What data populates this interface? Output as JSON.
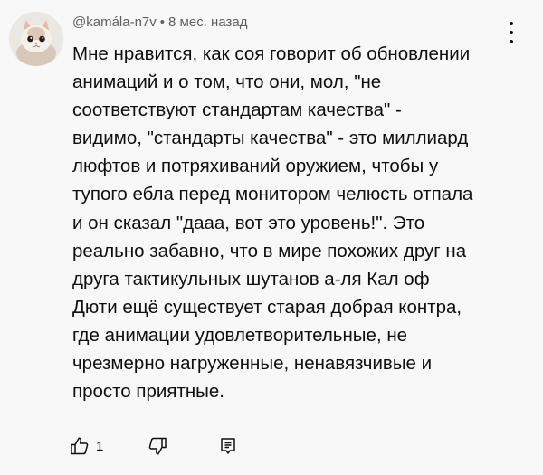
{
  "comment": {
    "author": "@kamála-n7v",
    "separator": "•",
    "time": "8 мес. назад",
    "text_lines": [
      "Мне нравится, как соя говорит об обновлении",
      "анимаций и о том, что они, мол, \"не",
      "соответствуют стандартам качества\" -",
      "видимо, \"стандарты качества\" - это миллиард",
      "люфтов и потряхиваний оружием, чтобы у",
      "тупого ебла перед монитором челюсть отпала",
      "и он сказал \"дааа, вот это уровень!\". Это",
      "реально забавно, что в мире похожих друг на",
      "друга тактикульных шутанов а-ля Кал оф",
      "Дюти ещё существует старая добрая контра,",
      "где анимации удовлетворительные, не",
      "чрезмерно нагруженные, ненавязчивые и",
      "просто приятные."
    ],
    "like_count": "1",
    "icons": {
      "avatar": "kitten-avatar",
      "more": "vertical-ellipsis-icon",
      "like": "thumbs-up-icon",
      "dislike": "thumbs-down-icon",
      "reply": "reply-icon"
    },
    "colors": {
      "background": "#f8f8f8",
      "text": "#0f0f0f",
      "meta": "#606060"
    }
  }
}
